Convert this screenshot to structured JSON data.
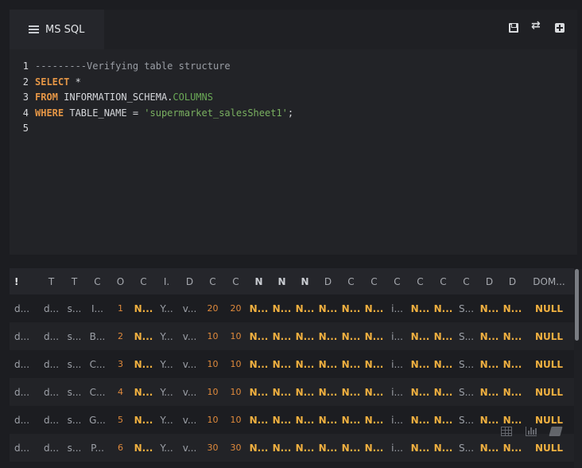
{
  "tab": {
    "label": "MS SQL",
    "icon": "database-icon"
  },
  "toolbar": {
    "save_icon": "save-icon",
    "swap_icon": "swap-icon",
    "add_icon": "add-icon"
  },
  "code": {
    "lines": [
      {
        "n": "1",
        "comment": "---------Verifying table structure"
      },
      {
        "n": "2",
        "kw": "SELECT",
        "rest": " *"
      },
      {
        "n": "3",
        "kw": "FROM",
        "id": " INFORMATION_SCHEMA.",
        "col": "COLUMNS"
      },
      {
        "n": "4",
        "kw": "WHERE",
        "id": " TABLE_NAME = ",
        "str": "'supermarket_salesSheet1'",
        "end": ";"
      },
      {
        "n": "5"
      }
    ]
  },
  "grid": {
    "headers": [
      "!",
      "T",
      "T",
      "C",
      "O",
      "C",
      "I.",
      "D",
      "C",
      "C",
      "N",
      "N",
      "N",
      "D",
      "C",
      "C",
      "C",
      "C",
      "C",
      "C",
      "D",
      "D",
      "DOM..."
    ],
    "rows": [
      [
        "d...",
        "d...",
        "s...",
        "I...",
        "1",
        "N...",
        "Y...",
        "v...",
        "20",
        "20",
        "N...",
        "N...",
        "N...",
        "N...",
        "N...",
        "N...",
        "i...",
        "N...",
        "N...",
        "S...",
        "N...",
        "N...",
        "NULL"
      ],
      [
        "d...",
        "d...",
        "s...",
        "B...",
        "2",
        "N...",
        "Y...",
        "v...",
        "10",
        "10",
        "N...",
        "N...",
        "N...",
        "N...",
        "N...",
        "N...",
        "i...",
        "N...",
        "N...",
        "S...",
        "N...",
        "N...",
        "NULL"
      ],
      [
        "d...",
        "d...",
        "s...",
        "C...",
        "3",
        "N...",
        "Y...",
        "v...",
        "10",
        "10",
        "N...",
        "N...",
        "N...",
        "N...",
        "N...",
        "N...",
        "i...",
        "N...",
        "N...",
        "S...",
        "N...",
        "N...",
        "NULL"
      ],
      [
        "d...",
        "d...",
        "s...",
        "C...",
        "4",
        "N...",
        "Y...",
        "v...",
        "10",
        "10",
        "N...",
        "N...",
        "N...",
        "N...",
        "N...",
        "N...",
        "i...",
        "N...",
        "N...",
        "S...",
        "N...",
        "N...",
        "NULL"
      ],
      [
        "d...",
        "d...",
        "s...",
        "G...",
        "5",
        "N...",
        "Y...",
        "v...",
        "10",
        "10",
        "N...",
        "N...",
        "N...",
        "N...",
        "N...",
        "N...",
        "i...",
        "N...",
        "N...",
        "S...",
        "N...",
        "N...",
        "NULL"
      ],
      [
        "d...",
        "d...",
        "s...",
        "P...",
        "6",
        "N...",
        "Y...",
        "v...",
        "30",
        "30",
        "N...",
        "N...",
        "N...",
        "N...",
        "N...",
        "N...",
        "i...",
        "N...",
        "N...",
        "S...",
        "N...",
        "N...",
        "NULL"
      ]
    ]
  },
  "result_tools": {
    "table_icon": "table-icon",
    "chart_icon": "bar-chart-icon",
    "notes_icon": "notebook-icon"
  }
}
